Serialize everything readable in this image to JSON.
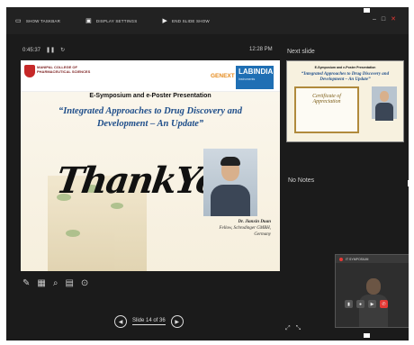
{
  "toolbar": {
    "items": [
      {
        "label": "SHOW TASKBAR",
        "icon": "taskbar-icon"
      },
      {
        "label": "DISPLAY SETTINGS",
        "icon": "display-settings-icon"
      },
      {
        "label": "END SLIDE SHOW",
        "icon": "end-slideshow-icon"
      }
    ]
  },
  "timer": {
    "elapsed": "0:45:37",
    "pause_icon": "pause-icon",
    "reset_icon": "reset-icon"
  },
  "clock": "12:28 PM",
  "next_slide_label": "Next slide",
  "notes_label": "No Notes",
  "slide": {
    "college_name": "MANIPAL COLLEGE OF PHARMACEUTICAL SCIENCES",
    "genext": "GENEXT",
    "sponsor": "LABINDIA",
    "sponsor_sub": "Instruments",
    "event": "E-Symposium and e-Poster Presentation",
    "title": "“Integrated Approaches to Drug Discovery and Development – An Update”",
    "thank_you": "ThankYou",
    "speaker_name": "Dr. Jianxin Duan",
    "speaker_role": "Fellow, Schrodinger GMBH,",
    "speaker_country": "Germany"
  },
  "next_slide": {
    "event": "E-Symposium and e-Poster Presentation",
    "title": "“Integrated Approaches to Drug Discovery and Development – An Update”",
    "certificate": "Certificate of Appreciation"
  },
  "navigation": {
    "text": "Slide 14 of 36"
  },
  "video_call": {
    "title": "IT SYMPOSIUM"
  },
  "colors": {
    "background": "#1b1b1b",
    "accent_title": "#1f4e8a",
    "end_call": "#e53935"
  }
}
